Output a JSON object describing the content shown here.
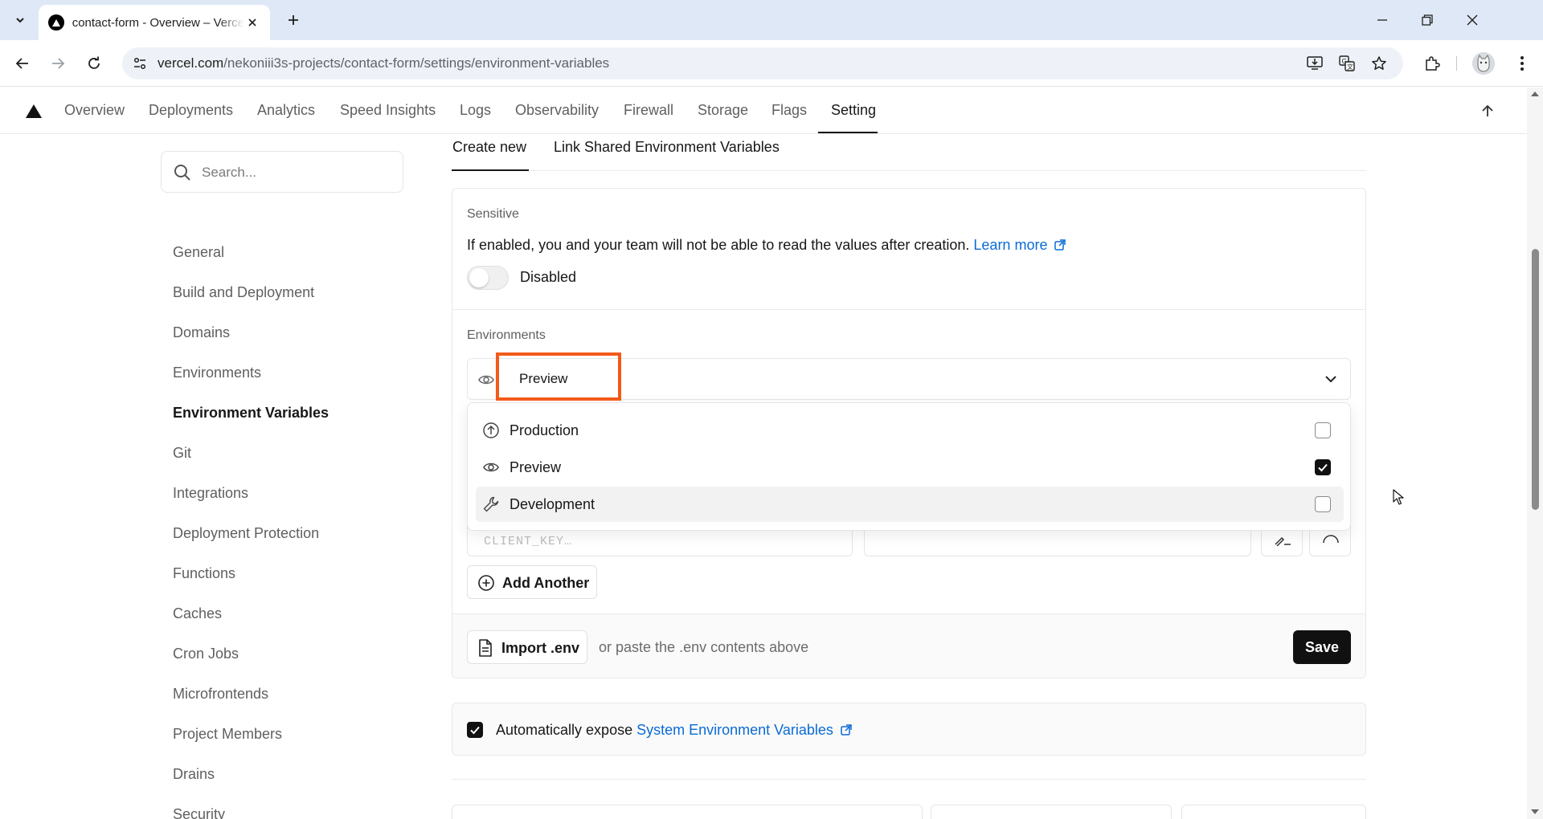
{
  "browser": {
    "tab_title": "contact-form - Overview – Vercel",
    "url_host": "vercel.com",
    "url_path": "/nekoniii3s-projects/contact-form/settings/environment-variables"
  },
  "appnav": {
    "items": [
      "Overview",
      "Deployments",
      "Analytics",
      "Speed Insights",
      "Logs",
      "Observability",
      "Firewall",
      "Storage",
      "Flags",
      "Setting"
    ],
    "active": "Setting"
  },
  "sidebar": {
    "search_placeholder": "Search...",
    "items": [
      "General",
      "Build and Deployment",
      "Domains",
      "Environments",
      "Environment Variables",
      "Git",
      "Integrations",
      "Deployment Protection",
      "Functions",
      "Caches",
      "Cron Jobs",
      "Microfrontends",
      "Project Members",
      "Drains",
      "Security"
    ],
    "active": "Environment Variables"
  },
  "main": {
    "tabs": [
      "Create new",
      "Link Shared Environment Variables"
    ],
    "sensitive": {
      "label": "Sensitive",
      "description": "If enabled, you and your team will not be able to read the values after creation.",
      "learn_more": "Learn more",
      "toggle_label": "Disabled"
    },
    "environments": {
      "label": "Environments",
      "selected": "Preview",
      "options": [
        {
          "label": "Production",
          "icon": "arrow-up-circle-icon",
          "checked": false
        },
        {
          "label": "Preview",
          "icon": "eye-icon",
          "checked": true
        },
        {
          "label": "Development",
          "icon": "wrench-icon",
          "checked": false
        }
      ]
    },
    "key_placeholder": "CLIENT_KEY…",
    "add_another": "Add Another",
    "import_env": "Import .env",
    "paste_hint": "or paste the .env contents above",
    "save": "Save",
    "expose": {
      "text": "Automatically expose",
      "link": "System Environment Variables",
      "checked": true
    }
  },
  "colors": {
    "accent_link": "#0a6bd6",
    "highlight": "#f25a1a",
    "primary_button": "#111111"
  }
}
